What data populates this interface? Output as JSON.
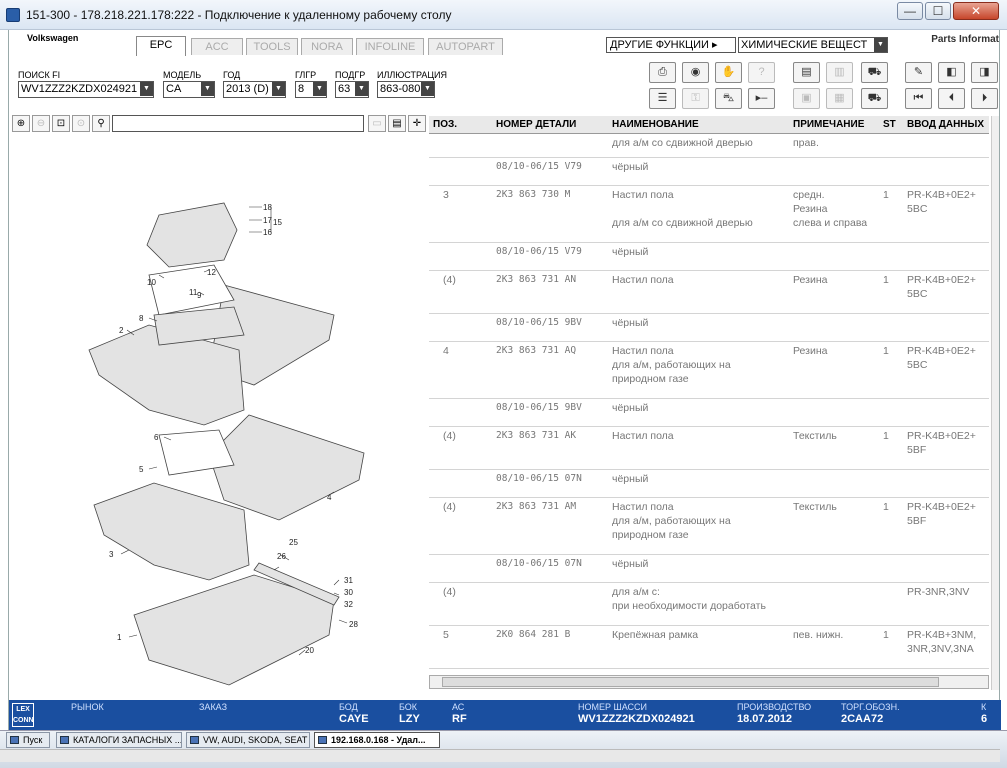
{
  "window": {
    "title": "151-300 - 178.218.221.178:222 - Подключение к удаленному рабочему столу",
    "btn_min": "—",
    "btn_max": "☐",
    "btn_close": "✕"
  },
  "app": {
    "brand": "Volkswagen",
    "brand_right": "Parts Informat"
  },
  "tabs": [
    "EPC",
    "ACC",
    "TOOLS",
    "NORA",
    "INFOLINE",
    "AUTOPART"
  ],
  "functions": {
    "label": "ДРУГИЕ ФУНКЦИИ ▸",
    "combo_value": "ХИМИЧЕСКИЕ ВЕЩЕСТ"
  },
  "filters": {
    "labels": {
      "search": "ПОИСК FI",
      "model": "МОДЕЛЬ",
      "year": "ГОД",
      "mg": "ГЛГР",
      "sg": "ПОДГР",
      "illus": "ИЛЛЮСТРАЦИЯ"
    },
    "values": {
      "search": "WV1ZZZ2KZDX024921",
      "model": "CA",
      "year": "2013 (D)",
      "mg": "8",
      "sg": "63",
      "illus": "863-080"
    }
  },
  "toolbar_icons": [
    "print-icon",
    "scanner-icon",
    "handshake-icon",
    "search-text-icon",
    "elsa-icon",
    "import-icon",
    "cart-add-icon",
    "pin-icon",
    "list-back-icon",
    "list-forward-icon",
    "list-icon",
    "key-icon",
    "car-icon",
    "step-icon",
    "image-icon",
    "image-print-icon",
    "cart-icon",
    "first-icon",
    "prev-icon",
    "next-icon"
  ],
  "grid": {
    "headers": {
      "pos": "ПОЗ.",
      "part": "НОМЕР ДЕТАЛИ",
      "name": "НАИМЕНОВАНИЕ",
      "note": "ПРИМЕЧАНИЕ",
      "st": "ST",
      "input": "ВВОД ДАННЫХ"
    },
    "rows": [
      {
        "h": 24,
        "pos": "",
        "part": "",
        "name": [
          "для а/м со сдвижной дверью"
        ],
        "note": [
          "прав."
        ],
        "st": "",
        "input": []
      },
      {
        "h": 28,
        "pos": "",
        "part": "08/10-06/15 V79",
        "name": [
          "чёрный"
        ],
        "note": [],
        "st": "",
        "input": []
      },
      {
        "h": 57,
        "pos": "3",
        "part": "2K3 863 730 M",
        "name": [
          "Настил пола",
          "",
          "для а/м со сдвижной дверью"
        ],
        "note": [
          "средн.",
          "Резина",
          "слева и справа"
        ],
        "st": "1",
        "input": [
          "PR-K4B+0E2+",
          "5BC"
        ]
      },
      {
        "h": 28,
        "pos": "",
        "part": "08/10-06/15 V79",
        "name": [
          "чёрный"
        ],
        "note": [],
        "st": "",
        "input": []
      },
      {
        "h": 43,
        "pos": "(4)",
        "part": "2K3 863 731 AN",
        "name": [
          "Настил пола"
        ],
        "note": [
          "Резина"
        ],
        "st": "1",
        "input": [
          "PR-K4B+0E2+",
          "5BC"
        ]
      },
      {
        "h": 28,
        "pos": "",
        "part": "08/10-06/15 9BV",
        "name": [
          "чёрный"
        ],
        "note": [],
        "st": "",
        "input": []
      },
      {
        "h": 57,
        "pos": "4",
        "part": "2K3 863 731 AQ",
        "name": [
          "Настил пола",
          "для а/м, работающих на",
          "природном газе"
        ],
        "note": [
          "Резина"
        ],
        "st": "1",
        "input": [
          "PR-K4B+0E2+",
          "5BC"
        ]
      },
      {
        "h": 28,
        "pos": "",
        "part": "08/10-06/15 9BV",
        "name": [
          "чёрный"
        ],
        "note": [],
        "st": "",
        "input": []
      },
      {
        "h": 43,
        "pos": "(4)",
        "part": "2K3 863 731 AK",
        "name": [
          "Настил пола"
        ],
        "note": [
          "Текстиль"
        ],
        "st": "1",
        "input": [
          "PR-K4B+0E2+",
          "5BF"
        ]
      },
      {
        "h": 28,
        "pos": "",
        "part": "08/10-06/15 07N",
        "name": [
          "чёрный"
        ],
        "note": [],
        "st": "",
        "input": []
      },
      {
        "h": 57,
        "pos": "(4)",
        "part": "2K3 863 731 AM",
        "name": [
          "Настил пола",
          "для а/м, работающих на",
          "природном газе"
        ],
        "note": [
          "Текстиль"
        ],
        "st": "1",
        "input": [
          "PR-K4B+0E2+",
          "5BF"
        ]
      },
      {
        "h": 28,
        "pos": "",
        "part": "08/10-06/15 07N",
        "name": [
          "чёрный"
        ],
        "note": [],
        "st": "",
        "input": []
      },
      {
        "h": 43,
        "pos": "(4)",
        "part": "",
        "name": [
          "                              для а/м с:",
          "при необходимости доработать"
        ],
        "note": [],
        "st": "",
        "input": [
          "PR-3NR,3NV"
        ]
      },
      {
        "h": 43,
        "pos": "5",
        "part": "2K0 864 281 B",
        "name": [
          "Крепёжная рамка"
        ],
        "note": [
          "пев. нижн."
        ],
        "st": "1",
        "input": [
          "PR-K4B+3NM,",
          "3NR,3NV,3NA"
        ]
      }
    ]
  },
  "diagram": {
    "callouts": [
      "18",
      "17",
      "16",
      "15",
      "12",
      "11",
      "10",
      "9",
      "8",
      "2",
      "6",
      "5",
      "4",
      "3",
      "25",
      "26",
      "31",
      "30",
      "32",
      "28",
      "1",
      "20"
    ]
  },
  "statusbar": {
    "logo": "LEX CONN",
    "market": {
      "label": "РЫНОК",
      "value": ""
    },
    "order": {
      "label": "ЗАКАЗ",
      "value": ""
    },
    "bod": {
      "label": "БОД",
      "value": "CAYE"
    },
    "bok": {
      "label": "БОК",
      "value": "LZY"
    },
    "ac": {
      "label": "АС",
      "value": "RF"
    },
    "chassis": {
      "label": "НОМЕР ШАССИ",
      "value": "WV1ZZZ2KZDX024921"
    },
    "production": {
      "label": "ПРОИЗВОДСТВО",
      "value": "18.07.2012"
    },
    "trade": {
      "label": "ТОРГ.ОБОЗН.",
      "value": "2CAA72"
    },
    "extra": {
      "label": "К",
      "value": "6"
    }
  },
  "taskbar": {
    "start": "Пуск",
    "items": [
      "КАТАЛОГИ ЗАПАСНЫХ ...",
      "VW, AUDI, SKODA, SEAT",
      "192.168.0.168 - Удал..."
    ]
  }
}
